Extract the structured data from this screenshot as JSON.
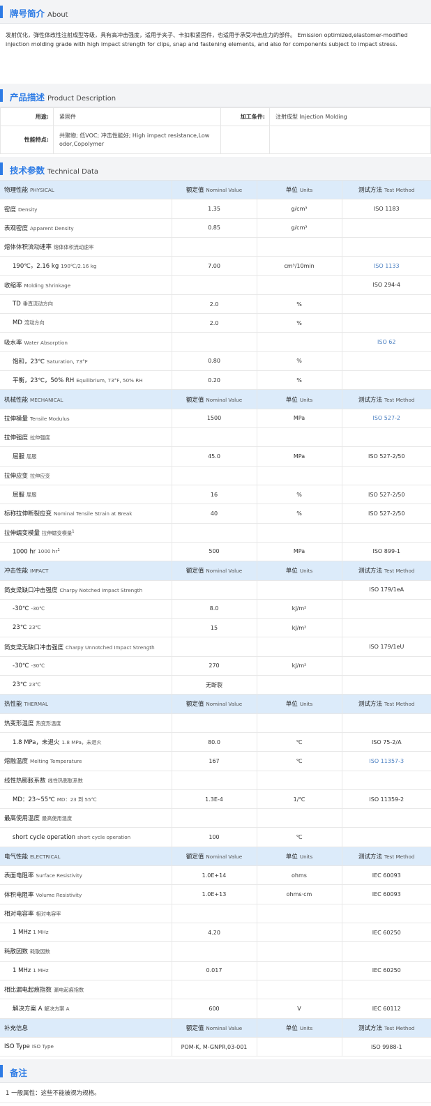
{
  "about": {
    "title_zh": "牌号简介",
    "title_en": "About",
    "text_zh": "发射优化，弹性体改性注射成型等级，具有高冲击强度，适用于夹子、卡扣和紧固件，也适用于承受冲击应力的部件。",
    "text_en": "Emission optimized,elastomer-modified injection molding grade with high impact strength for clips, snap and fastening elements, and also for components subject to impact stress."
  },
  "product": {
    "title_zh": "产品描述",
    "title_en": "Product Description",
    "use_label": "用途:",
    "use_value": "紧固件",
    "process_label": "加工条件:",
    "process_value": "注射成型  Injection Molding",
    "feature_label": "性能特点:",
    "feature_value": "共聚物; 低VOC; 冲击性能好;  High impact resistance,Low odor,Copolymer"
  },
  "technical": {
    "title_zh": "技术参数",
    "title_en": "Technical Data",
    "header": {
      "nominal_zh": "额定值",
      "nominal_en": "Nominal Value",
      "units_zh": "单位",
      "units_en": "Units",
      "method_zh": "测试方法",
      "method_en": "Test Method"
    },
    "rows": [
      {
        "type": "cat",
        "zh": "物理性能",
        "en": "PHYSICAL"
      },
      {
        "zh": "密度",
        "en": "Density",
        "value": "1.35",
        "unit": "g/cm³",
        "method": "ISO 1183"
      },
      {
        "zh": "表观密度",
        "en": "Apparent Density",
        "value": "0.85",
        "unit": "g/cm³",
        "method": ""
      },
      {
        "zh": "熔体体积流动速率",
        "en": "熔体体积流动速率",
        "value": "",
        "unit": "",
        "method": ""
      },
      {
        "zh": "190℃，2.16 kg",
        "en": "190℃/2.16 kg",
        "value": "7.00",
        "unit": "cm³/10min",
        "method": "ISO 1133",
        "link": true,
        "indent": true
      },
      {
        "zh": "收缩率",
        "en": "Molding Shrinkage",
        "value": "",
        "unit": "",
        "method": "ISO 294-4"
      },
      {
        "zh": "TD",
        "en": "垂直流动方向",
        "value": "2.0",
        "unit": "%",
        "method": "",
        "indent": true
      },
      {
        "zh": "MD",
        "en": "流动方向",
        "value": "2.0",
        "unit": "%",
        "method": "",
        "indent": true
      },
      {
        "zh": "吸水率",
        "en": "Water Absorption",
        "value": "",
        "unit": "",
        "method": "ISO 62",
        "link": true
      },
      {
        "zh": "饱和，23℃",
        "en": "Saturation, 73°F",
        "value": "0.80",
        "unit": "%",
        "method": "",
        "indent": true
      },
      {
        "zh": "平衡，23℃，50% RH",
        "en": "Equilibrium, 73°F, 50% RH",
        "value": "0.20",
        "unit": "%",
        "method": "",
        "indent": true
      },
      {
        "type": "cat",
        "zh": "机械性能",
        "en": "MECHANICAL"
      },
      {
        "zh": "拉伸模量",
        "en": "Tensile Modulus",
        "value": "1500",
        "unit": "MPa",
        "method": "ISO 527-2",
        "link": true
      },
      {
        "zh": "拉伸强度",
        "en": "拉伸强度",
        "value": "",
        "unit": "",
        "method": ""
      },
      {
        "zh": "屈服",
        "en": "屈服",
        "value": "45.0",
        "unit": "MPa",
        "method": "ISO 527-2/50",
        "indent": true
      },
      {
        "zh": "拉伸应变",
        "en": "拉伸应变",
        "value": "",
        "unit": "",
        "method": ""
      },
      {
        "zh": "屈服",
        "en": "屈服",
        "value": "16",
        "unit": "%",
        "method": "ISO 527-2/50",
        "indent": true
      },
      {
        "zh": "标称拉伸断裂应变",
        "en": "Nominal Tensile Strain at Break",
        "value": "40",
        "unit": "%",
        "method": "ISO 527-2/50"
      },
      {
        "zh": "拉伸蠕变模量",
        "en": "拉伸蠕变模量",
        "sup": "1",
        "value": "",
        "unit": "",
        "method": ""
      },
      {
        "zh": "1000 hr",
        "en": "1000 hr",
        "sup": "1",
        "value": "500",
        "unit": "MPa",
        "method": "ISO 899-1",
        "indent": true
      },
      {
        "type": "cat",
        "zh": "冲击性能",
        "en": "IMPACT"
      },
      {
        "zh": "简支梁缺口冲击强度",
        "en": "Charpy Notched Impact Strength",
        "value": "",
        "unit": "",
        "method": "ISO 179/1eA"
      },
      {
        "zh": "-30℃",
        "en": "-30℃",
        "value": "8.0",
        "unit": "kJ/m²",
        "method": "",
        "indent": true
      },
      {
        "zh": "23℃",
        "en": "23℃",
        "value": "15",
        "unit": "kJ/m²",
        "method": "",
        "indent": true
      },
      {
        "zh": "简支梁无缺口冲击强度",
        "en": "Charpy Unnotched Impact Strength",
        "value": "",
        "unit": "",
        "method": "ISO 179/1eU"
      },
      {
        "zh": "-30℃",
        "en": "-30℃",
        "value": "270",
        "unit": "kJ/m²",
        "method": "",
        "indent": true
      },
      {
        "zh": "23℃",
        "en": "23℃",
        "value": "无断裂",
        "unit": "",
        "method": "",
        "indent": true
      },
      {
        "type": "cat",
        "zh": "热性能",
        "en": "THERMAL"
      },
      {
        "zh": "热变形温度",
        "en": "热变形温度",
        "value": "",
        "unit": "",
        "method": ""
      },
      {
        "zh": "1.8 MPa，未退火",
        "en": "1.8 MPa，未退火",
        "value": "80.0",
        "unit": "℃",
        "method": "ISO 75-2/A",
        "indent": true
      },
      {
        "zh": "熔融温度",
        "en": "Melting Temperature",
        "value": "167",
        "unit": "℃",
        "method": "ISO 11357-3",
        "link": true
      },
      {
        "zh": "线性热膨胀系数",
        "en": "线性热膨胀系数",
        "value": "",
        "unit": "",
        "method": ""
      },
      {
        "zh": "MD：23~55℃",
        "en": "MD：23 到 55℃",
        "value": "1.3E-4",
        "unit": "1/℃",
        "method": "ISO 11359-2",
        "indent": true
      },
      {
        "zh": "最高使用温度",
        "en": "最高使用温度",
        "value": "",
        "unit": "",
        "method": ""
      },
      {
        "zh": "short cycle operation",
        "en": "short cycle operation",
        "value": "100",
        "unit": "℃",
        "method": "",
        "indent": true
      },
      {
        "type": "cat",
        "zh": "电气性能",
        "en": "ELECTRICAL"
      },
      {
        "zh": "表面电阻率",
        "en": "Surface Resistivity",
        "value": "1.0E+14",
        "unit": "ohms",
        "method": "IEC 60093"
      },
      {
        "zh": "体积电阻率",
        "en": "Volume Resistivity",
        "value": "1.0E+13",
        "unit": "ohms·cm",
        "method": "IEC 60093"
      },
      {
        "zh": "相对电容率",
        "en": "相对电容率",
        "value": "",
        "unit": "",
        "method": ""
      },
      {
        "zh": "1 MHz",
        "en": "1 MHz",
        "value": "4.20",
        "unit": "",
        "method": "IEC 60250",
        "indent": true
      },
      {
        "zh": "耗散因数",
        "en": "耗散因数",
        "value": "",
        "unit": "",
        "method": ""
      },
      {
        "zh": "1 MHz",
        "en": "1 MHz",
        "value": "0.017",
        "unit": "",
        "method": "IEC 60250",
        "indent": true
      },
      {
        "zh": "相比漏电起痕指数",
        "en": "漏电起痕指数",
        "value": "",
        "unit": "",
        "method": ""
      },
      {
        "zh": "解决方案 A",
        "en": "解决方案 A",
        "value": "600",
        "unit": "V",
        "method": "IEC 60112",
        "indent": true
      },
      {
        "type": "cat",
        "zh": "补充信息",
        "en": ""
      },
      {
        "zh": "ISO Type",
        "en": "ISO Type",
        "value": "POM-K, M-GNPR,03-001",
        "unit": "",
        "method": "ISO 9988-1"
      }
    ]
  },
  "notes": {
    "title_zh": "备注",
    "text": "1 一般属性：这些不能被视为规格。"
  }
}
